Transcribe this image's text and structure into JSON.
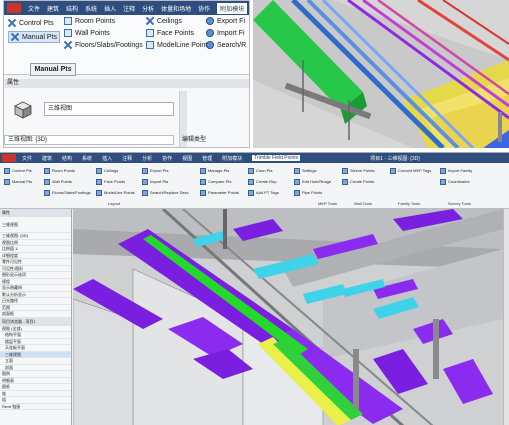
{
  "top_left": {
    "tabs": [
      "文件",
      "建筑",
      "结构",
      "系统",
      "插入",
      "注释",
      "分析",
      "体量和场地",
      "协作",
      "视图",
      "管理",
      "附加模块",
      "修改"
    ],
    "active_tab": "附加模块",
    "ribbon": [
      {
        "label": "Control Pts",
        "icon": "control-pts-icon"
      },
      {
        "label": "Manual Pts",
        "icon": "manual-pts-icon"
      },
      {
        "label": "Room Points",
        "icon": "room-points-icon"
      },
      {
        "label": "Wall Points",
        "icon": "wall-points-icon"
      },
      {
        "label": "Floors/Slabs/Footings",
        "icon": "floors-icon"
      },
      {
        "label": "Ceilings",
        "icon": "ceilings-icon"
      },
      {
        "label": "Face Points",
        "icon": "face-points-icon"
      },
      {
        "label": "ModelLine Points",
        "icon": "modelline-points-icon"
      },
      {
        "label": "Export Fi",
        "icon": "export-icon"
      },
      {
        "label": "Import Fi",
        "icon": "import-icon"
      },
      {
        "label": "Search/R",
        "icon": "search-icon"
      }
    ],
    "tooltip": "Manual Pts",
    "properties": {
      "title": "属性",
      "type_name": "三维视图",
      "selector": "三维视图: {3D}",
      "edit_type": "编辑类型"
    }
  },
  "bottom": {
    "titlebar": "项目1 - 三维视图: {3D}",
    "tabs": [
      "文件",
      "建筑",
      "结构",
      "系统",
      "插入",
      "注释",
      "分析",
      "协作",
      "视图",
      "管理",
      "附加模块",
      "Trimble Field Points"
    ],
    "groups": [
      {
        "label": "",
        "items": [
          "Control Pts",
          "Manual Pts",
          "Room Points",
          "Wall Points",
          "Floors/Slabs/Footings"
        ]
      },
      {
        "label": "Layout",
        "items": [
          "Ceilings",
          "Face Points",
          "ModelLine Points"
        ]
      },
      {
        "label": "",
        "items": [
          "Export Pts",
          "Import Pts",
          "Search/Replace Desc"
        ]
      },
      {
        "label": "",
        "items": [
          "Manage Pts",
          "Compare Pts",
          "Parameter Points"
        ]
      },
      {
        "label": "",
        "items": [
          "Conn Pts",
          "Create Rep.",
          "Add PT Tags"
        ]
      },
      {
        "label": "MEP Tools",
        "items": [
          "Settings",
          "Edit Hole/Rhage",
          "Pipe Points"
        ]
      },
      {
        "label": "Wall Tools",
        "items": [
          "Sleeve Points",
          "Create Points"
        ]
      },
      {
        "label": "Family Tools",
        "items": [
          "Convert MEP Tags"
        ]
      },
      {
        "label": "Survey Tools",
        "items": [
          "Import Family",
          "Coordinates"
        ]
      }
    ],
    "left_panel": {
      "header": "属性",
      "type": "三维视图",
      "rows": [
        "三维视图: {3D}",
        "视图比例",
        "比例值 1:",
        "详细程度",
        "零件可见性",
        "可见性/图形",
        "图形显示选项",
        "规程",
        "显示隐藏线",
        "默认分析显示",
        "日光路径",
        "范围",
        "剖面框",
        "项目浏览器 - 项目1",
        "视图 (全部)",
        "结构平面",
        "楼层平面",
        "天花板平面",
        "三维视图",
        "立面",
        "剖面",
        "图例",
        "明细表",
        "图纸",
        "族",
        "组",
        "Revit 链接"
      ]
    }
  }
}
